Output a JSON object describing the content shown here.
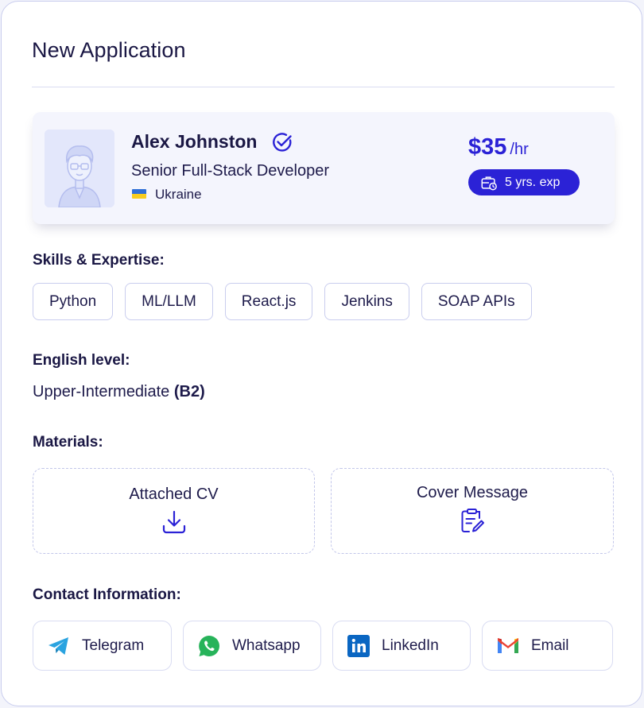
{
  "header": {
    "title": "New Application"
  },
  "candidate": {
    "name": "Alex Johnston",
    "role": "Senior Full-Stack Developer",
    "country": "Ukraine",
    "rate": "$35",
    "rate_unit": "/hr",
    "experience": "5 yrs. exp"
  },
  "skills": {
    "heading": "Skills & Expertise:",
    "items": [
      "Python",
      "ML/LLM",
      "React.js",
      "Jenkins",
      "SOAP APIs"
    ]
  },
  "english": {
    "heading": "English level:",
    "level": "Upper-Intermediate",
    "code": "(B2)"
  },
  "materials": {
    "heading": "Materials:",
    "cv_label": "Attached CV",
    "cover_label": "Cover Message"
  },
  "contacts": {
    "heading": "Contact Information:",
    "items": [
      "Telegram",
      "Whatsapp",
      "LinkedIn",
      "Email"
    ]
  },
  "colors": {
    "accent": "#2b22d6",
    "border": "#c9cdee",
    "text": "#1a1744"
  },
  "icons": [
    "avatar-illustration",
    "verified-badge-icon",
    "ukraine-flag-icon",
    "briefcase-clock-icon",
    "download-icon",
    "document-edit-icon",
    "telegram-icon",
    "whatsapp-icon",
    "linkedin-icon",
    "gmail-icon"
  ]
}
